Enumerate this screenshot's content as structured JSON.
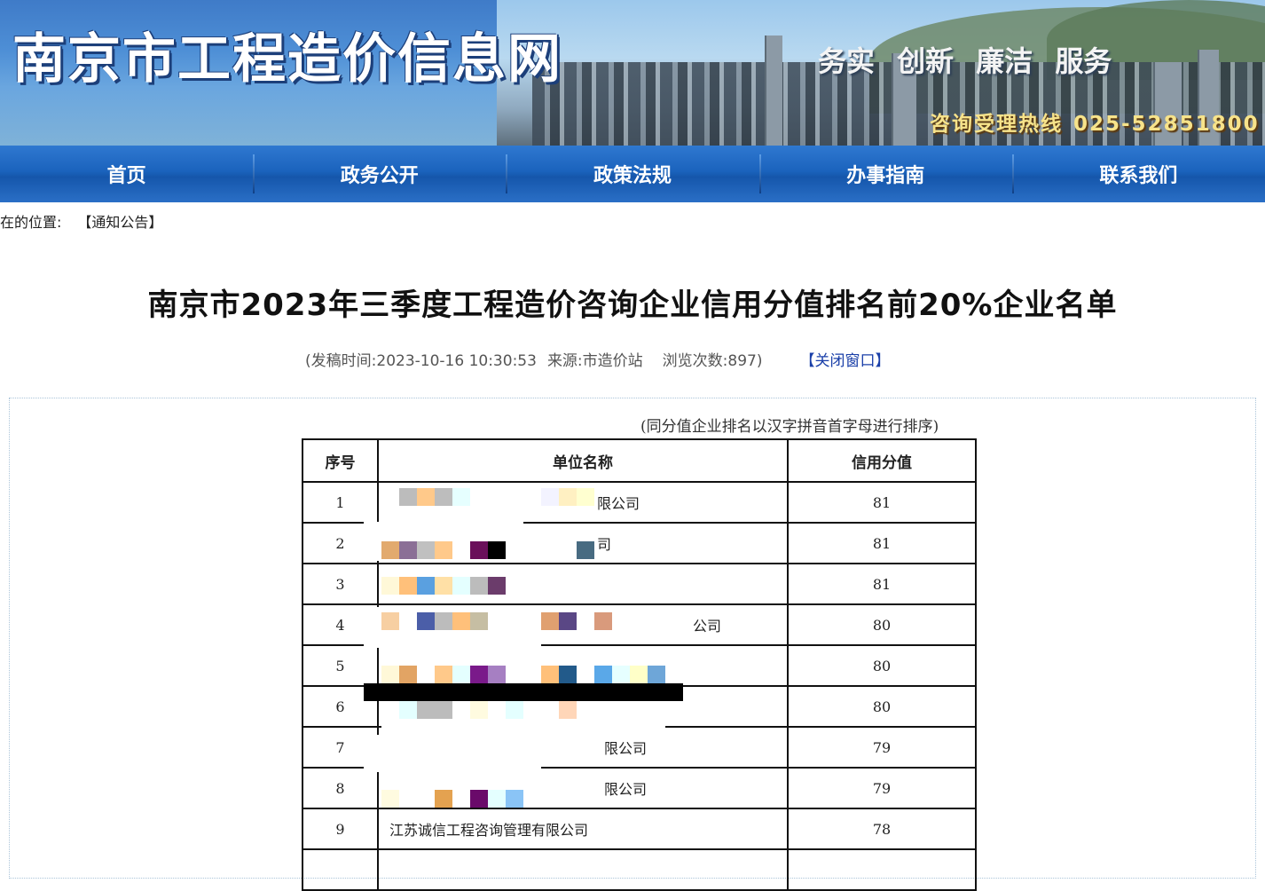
{
  "header": {
    "site_title": "南京市工程造价信息网",
    "slogan": "务实 创新 廉洁 服务",
    "hotline_label": "咨询受理热线",
    "hotline_number": "025-52851800"
  },
  "nav": {
    "items": [
      {
        "label": "首页"
      },
      {
        "label": "政务公开"
      },
      {
        "label": "政策法规"
      },
      {
        "label": "办事指南"
      },
      {
        "label": "联系我们"
      }
    ]
  },
  "breadcrumb": {
    "prefix": "在的位置:",
    "link": "【通知公告】"
  },
  "article": {
    "title": "南京市2023年三季度工程造价咨询企业信用分值排名前20%企业名单",
    "meta_open": "(发稿时间:",
    "publish_time": "2023-10-16 10:30:53",
    "source_label": "来源:",
    "source": "市造价站",
    "views_label": "浏览次数:",
    "views": "897)",
    "close_label": "【关闭窗口】",
    "note": "(同分值企业排名以汉字拼音首字母进行排序)"
  },
  "table": {
    "headers": [
      "序号",
      "单位名称",
      "信用分值"
    ],
    "rows": [
      {
        "no": "1",
        "name": "限公司",
        "score": "81"
      },
      {
        "no": "2",
        "name": "司",
        "score": "81"
      },
      {
        "no": "3",
        "name": "",
        "score": "81"
      },
      {
        "no": "4",
        "name": "公司",
        "score": "80"
      },
      {
        "no": "5",
        "name": "",
        "score": "80"
      },
      {
        "no": "6",
        "name": "",
        "score": "80"
      },
      {
        "no": "7",
        "name": "限公司",
        "score": "79"
      },
      {
        "no": "8",
        "name": "限公司",
        "score": "79"
      },
      {
        "no": "9",
        "name": "江苏诚信工程咨询管理有限公司",
        "score": "78"
      },
      {
        "no": "",
        "name": "",
        "score": ""
      }
    ]
  }
}
